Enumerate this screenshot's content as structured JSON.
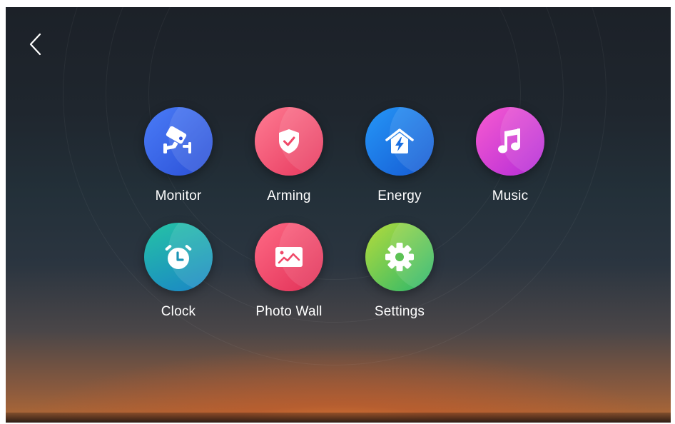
{
  "back": {
    "icon": "chevron-left-icon"
  },
  "apps": [
    {
      "label": "Monitor",
      "icon": "security-camera-icon",
      "colors": [
        "#3b6cf0",
        "#2a4fd6"
      ]
    },
    {
      "label": "Arming",
      "icon": "shield-check-icon",
      "colors": [
        "#ff6b86",
        "#e8385e"
      ]
    },
    {
      "label": "Energy",
      "icon": "house-bolt-icon",
      "colors": [
        "#1e8af5",
        "#1565d8"
      ]
    },
    {
      "label": "Music",
      "icon": "music-note-icon",
      "colors": [
        "#f04fc8",
        "#c42fd6"
      ]
    },
    {
      "label": "Clock",
      "icon": "alarm-clock-icon",
      "colors": [
        "#1fb6a8",
        "#1f7fc0"
      ]
    },
    {
      "label": "Photo Wall",
      "icon": "image-icon",
      "colors": [
        "#ff5b7c",
        "#e33358"
      ]
    },
    {
      "label": "Settings",
      "icon": "gear-icon",
      "colors": [
        "#9bd53c",
        "#2bb96a"
      ]
    }
  ]
}
